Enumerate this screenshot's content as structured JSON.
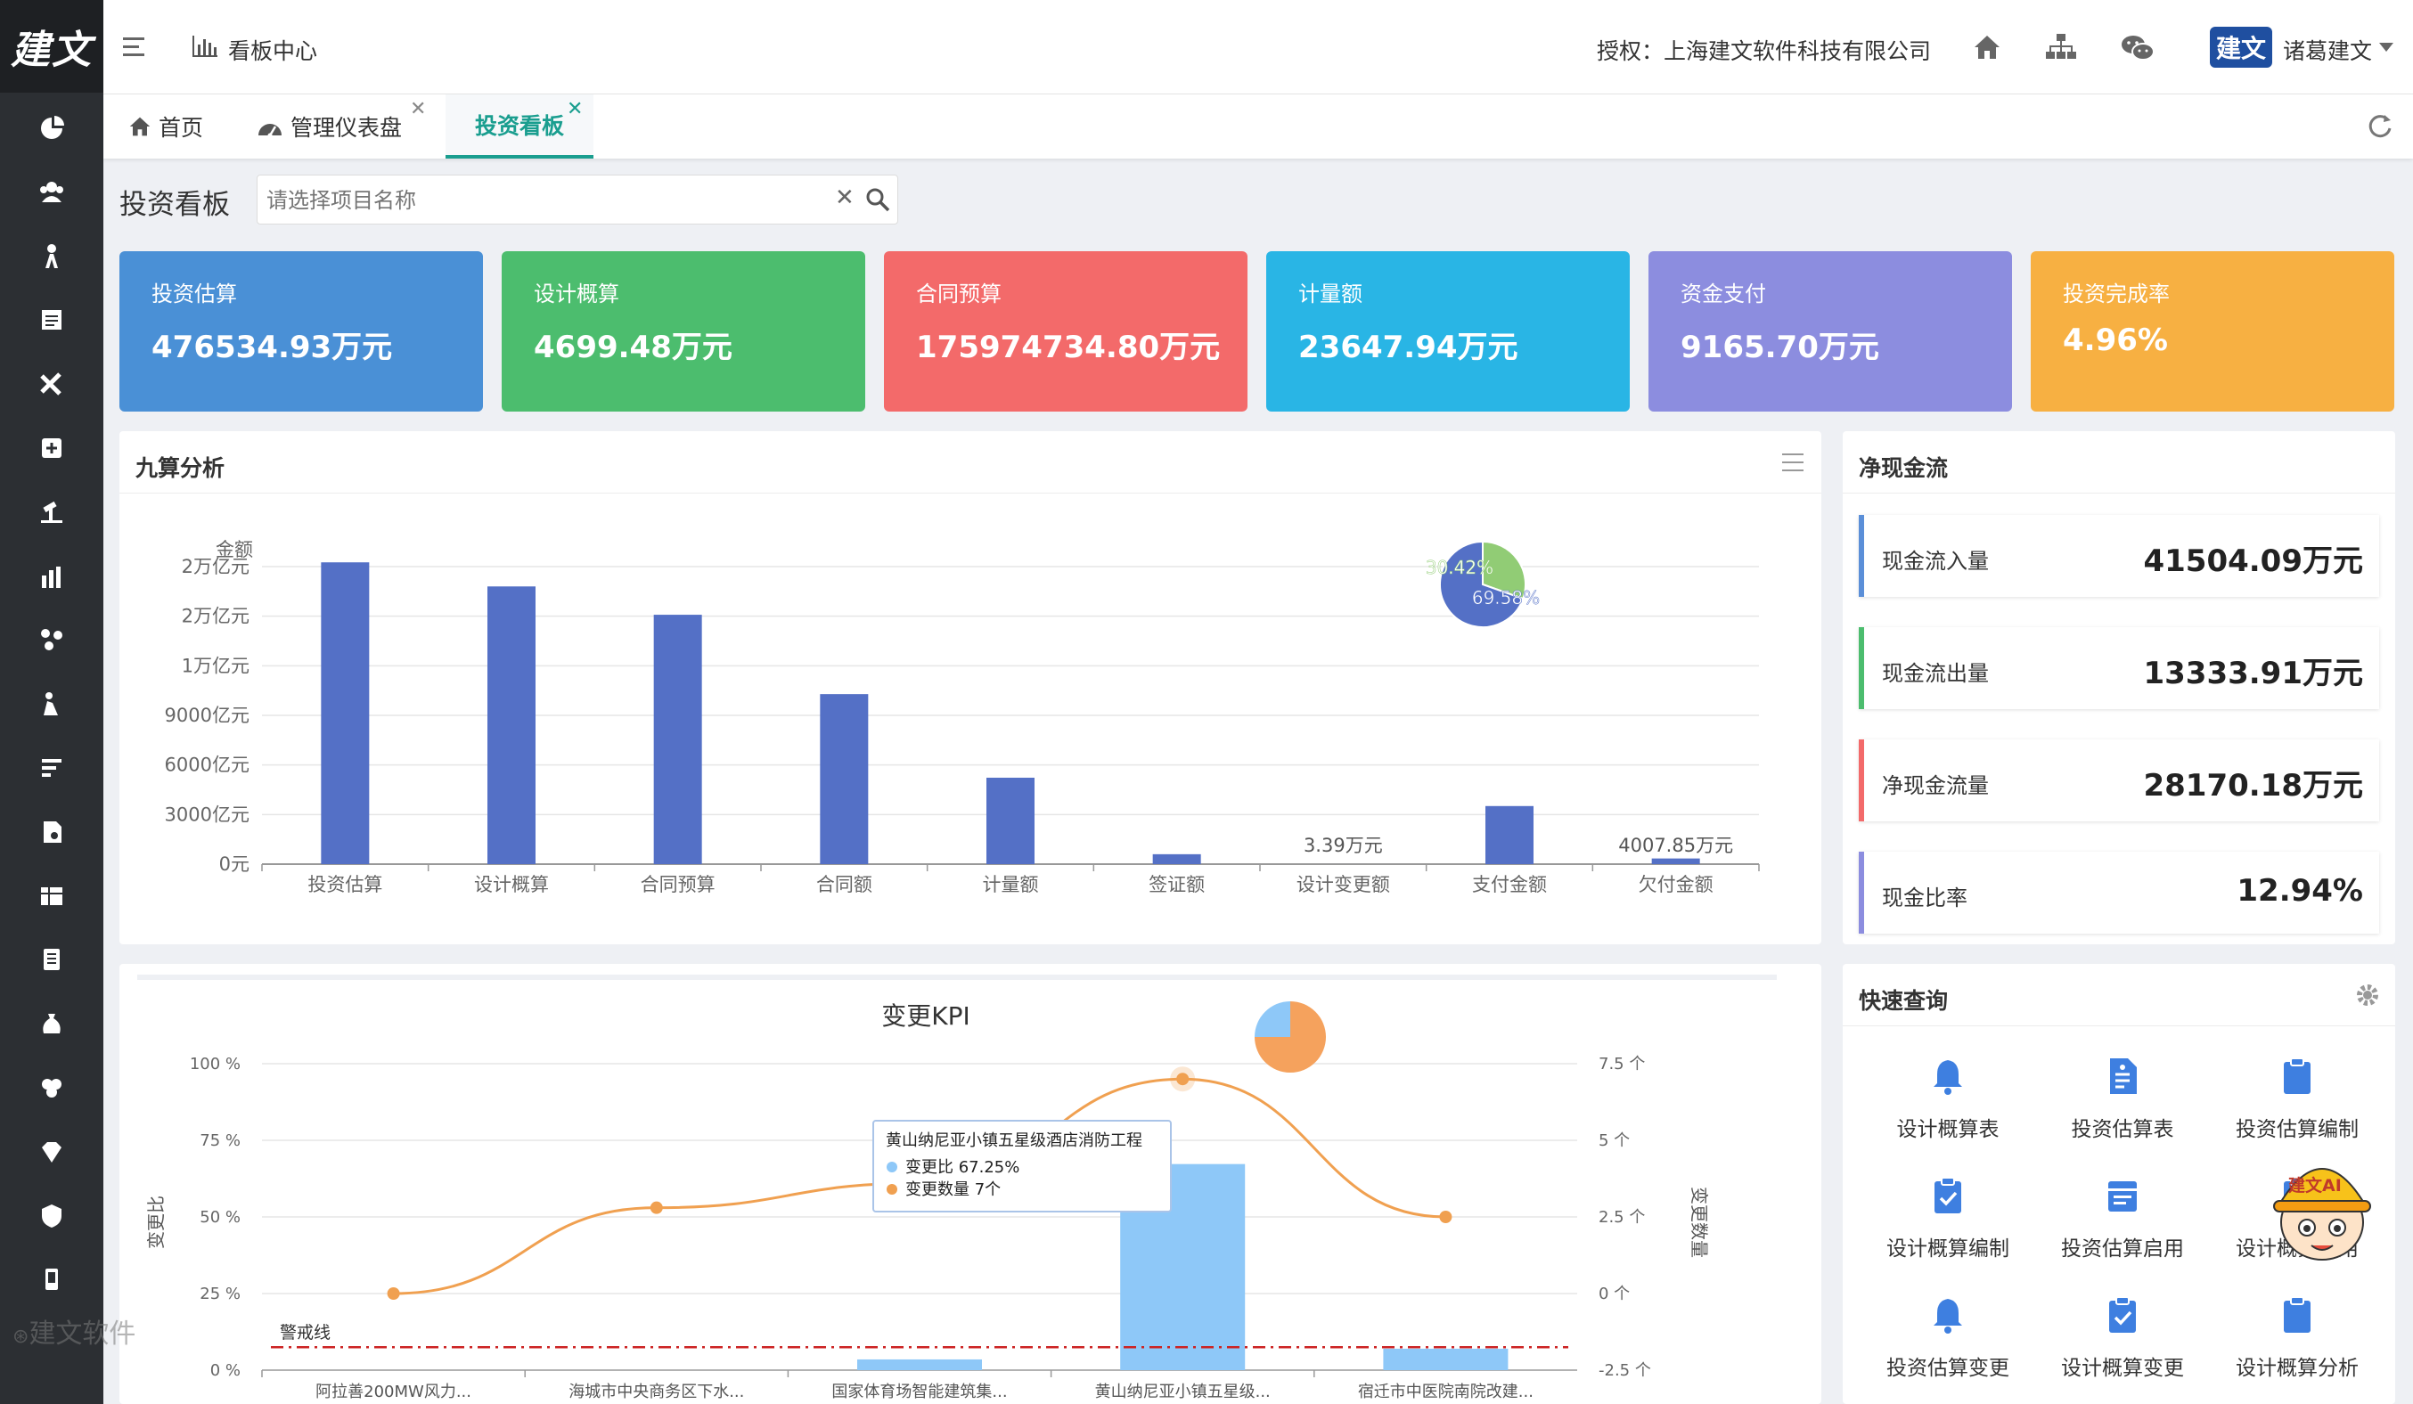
{
  "brand": {
    "logo_text": "建文",
    "watermark": "建文软件"
  },
  "header": {
    "menu_title": "看板中心",
    "license": "授权：上海建文软件科技有限公司",
    "user_name": "诸葛建文",
    "user_badge": "建文"
  },
  "tabs": [
    {
      "label": "首页",
      "active": false,
      "closable": false
    },
    {
      "label": "管理仪表盘",
      "active": false,
      "closable": true
    },
    {
      "label": "投资看板",
      "active": true,
      "closable": true
    }
  ],
  "page": {
    "title": "投资看板",
    "search_placeholder": "请选择项目名称"
  },
  "cards": [
    {
      "label": "投资估算",
      "value": "476534.93万元",
      "color": "#4a90d6"
    },
    {
      "label": "设计概算",
      "value": "4699.48万元",
      "color": "#4cbd6e"
    },
    {
      "label": "合同预算",
      "value": "175974734.80万元",
      "color": "#f36a6a"
    },
    {
      "label": "计量额",
      "value": "23647.94万元",
      "color": "#29b5e5"
    },
    {
      "label": "资金支付",
      "value": "9165.70万元",
      "color": "#8c8ddf"
    },
    {
      "label": "投资完成率",
      "value": "4.96%",
      "color": "#f7b042"
    }
  ],
  "nine_panel": {
    "title": "九算分析"
  },
  "cashflow": {
    "title": "净现金流",
    "items": [
      {
        "label": "现金流入量",
        "value": "41504.09万元",
        "color": "#5b8fd8"
      },
      {
        "label": "现金流出量",
        "value": "13333.91万元",
        "color": "#4cbd6e"
      },
      {
        "label": "净现金流量",
        "value": "28170.18万元",
        "color": "#f36a6a"
      },
      {
        "label": "现金比率",
        "value": "12.94%",
        "color": "#8c8ddf"
      }
    ]
  },
  "quick": {
    "title": "快速查询",
    "ai_label": "建文AI",
    "items": [
      {
        "label": "设计概算表",
        "icon": "bell-icon"
      },
      {
        "label": "投资估算表",
        "icon": "document-icon"
      },
      {
        "label": "投资估算编制",
        "icon": "clipboard-icon"
      },
      {
        "label": "设计概算编制",
        "icon": "clipboard-check-icon"
      },
      {
        "label": "投资估算启用",
        "icon": "calendar-icon"
      },
      {
        "label": "设计概算启用",
        "icon": "clipboard-list-icon"
      },
      {
        "label": "投资估算变更",
        "icon": "bell-icon"
      },
      {
        "label": "设计概算变更",
        "icon": "clipboard-check-icon"
      },
      {
        "label": "设计概算分析",
        "icon": "clipboard-icon"
      }
    ]
  },
  "chart_data": [
    {
      "type": "bar",
      "title": "九算分析",
      "ylabel": "金额",
      "y_ticks": [
        "0元",
        "3000亿元",
        "6000亿元",
        "9000亿元",
        "1万亿元",
        "2万亿元",
        "2万亿元"
      ],
      "ylim": [
        0,
        21000
      ],
      "categories": [
        "投资估算",
        "设计概算",
        "合同预算",
        "合同额",
        "计量额",
        "签证额",
        "设计变更额",
        "支付金额",
        "欠付金额"
      ],
      "values": [
        21300,
        19600,
        17600,
        12000,
        6100,
        700,
        0.3,
        4100,
        400
      ],
      "data_labels": [
        "",
        "",
        "",
        "",
        "",
        "",
        "3.39万元",
        "",
        "4007.85万元"
      ],
      "bar_color": "#5470c6",
      "inset_pie": {
        "slices": [
          {
            "value": 30.42,
            "label": "30.42%",
            "color": "#91cc75"
          },
          {
            "value": 69.58,
            "label": "69.58%",
            "color": "#5470c6"
          }
        ]
      }
    },
    {
      "type": "bar+line",
      "title": "变更KPI",
      "ylabel": "变更比",
      "y2label": "变更数量",
      "y_ticks": [
        "0 %",
        "25 %",
        "50 %",
        "75 %",
        "100 %"
      ],
      "y2_ticks": [
        "-2.5 个",
        "0 个",
        "2.5 个",
        "5 个",
        "7.5 个"
      ],
      "categories": [
        "阿拉善200MW风力...",
        "海城市中央商务区下水...",
        "国家体育场智能建筑集...",
        "黄山纳尼亚小镇五星级...",
        "宿迁市中医院南院改建..."
      ],
      "series": [
        {
          "name": "变更比",
          "type": "bar",
          "values": [
            0,
            0,
            3.5,
            67.25,
            7
          ],
          "unit": "%",
          "color": "#8ec8f8"
        },
        {
          "name": "变更数量",
          "type": "line",
          "values": [
            0,
            2.8,
            3.6,
            7,
            2.5
          ],
          "unit": "个",
          "color": "#f0a050"
        }
      ],
      "warning_line": {
        "label": "警戒线",
        "value": 7.5,
        "color": "#cc2222"
      },
      "tooltip": {
        "title": "黄山纳尼亚小镇五星级酒店消防工程",
        "rows": [
          "变更比  67.25%",
          "变更数量  7个"
        ]
      },
      "inset_pie": {
        "slices": [
          {
            "value": 75,
            "color": "#f5a25d"
          },
          {
            "value": 25,
            "color": "#8ec8f8"
          }
        ]
      }
    }
  ]
}
